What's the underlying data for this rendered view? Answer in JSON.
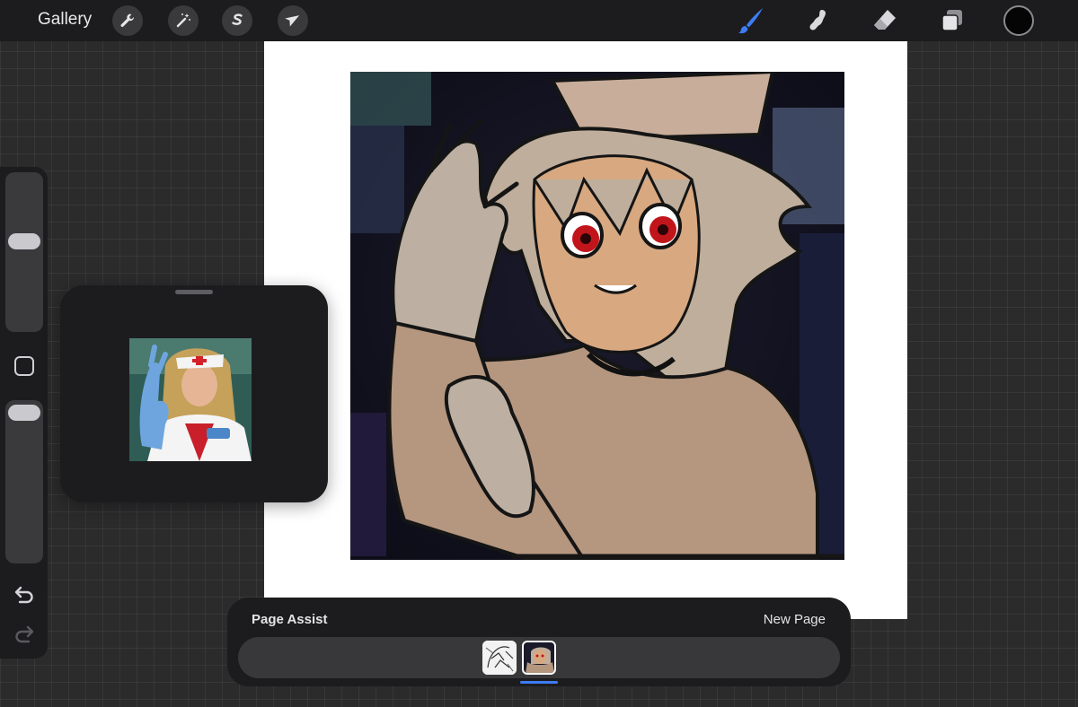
{
  "toolbar": {
    "gallery_label": "Gallery",
    "left_tools": [
      {
        "name": "actions",
        "icon": "wrench-icon"
      },
      {
        "name": "adjustments",
        "icon": "magic-wand-icon"
      },
      {
        "name": "selection",
        "icon": "selection-s-icon"
      },
      {
        "name": "transform",
        "icon": "arrow-cursor-icon"
      }
    ],
    "right_tools": [
      {
        "name": "brush",
        "icon": "brush-icon",
        "active": true
      },
      {
        "name": "smudge",
        "icon": "smudge-icon"
      },
      {
        "name": "eraser",
        "icon": "eraser-icon"
      },
      {
        "name": "layers",
        "icon": "layers-icon"
      }
    ],
    "current_color": "#050505",
    "accent_color": "#3d7cf5"
  },
  "sidebar": {
    "brush_size_level": 0.28,
    "opacity_level": 0.04,
    "icons": [
      "modifier-square-icon",
      "undo-icon",
      "redo-icon"
    ]
  },
  "reference_window": {
    "visible": true
  },
  "page_assist": {
    "title": "Page Assist",
    "new_page_label": "New Page",
    "pages": [
      {
        "index": 1,
        "kind": "lineart-sketch",
        "active": false
      },
      {
        "index": 2,
        "kind": "color-sketch",
        "active": true
      }
    ]
  }
}
